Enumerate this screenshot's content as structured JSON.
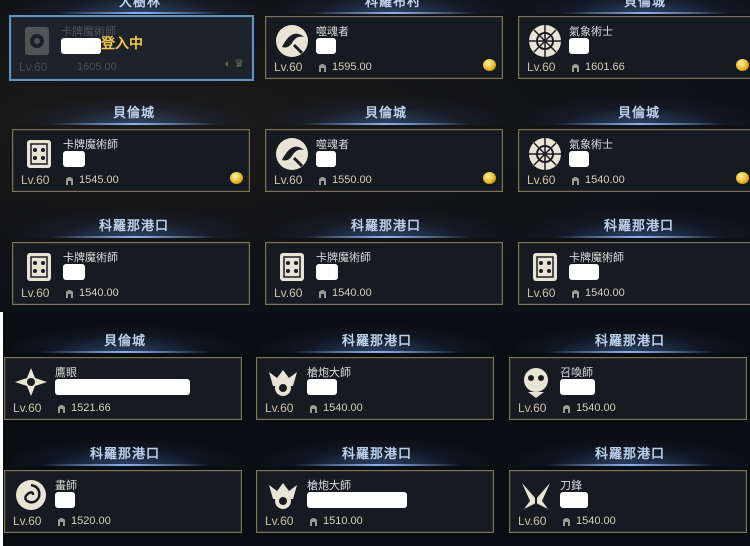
{
  "headers_top": [
    "大樹林",
    "科羅布村",
    "貝倫城"
  ],
  "row1": [
    {
      "class": "卡牌魔術師",
      "level": "Lv.60",
      "ilvl": "1605.00",
      "status": "登入中",
      "selected": true,
      "emblem": "card-master-emblem"
    },
    {
      "class": "噬魂者",
      "level": "Lv.60",
      "ilvl": "1595.00",
      "coin": true,
      "emblem": "reaper-emblem"
    },
    {
      "class": "氣象術士",
      "level": "Lv.60",
      "ilvl": "1601.66",
      "coin": true,
      "emblem": "aeromancer-emblem"
    }
  ],
  "headers_row2": [
    "貝倫城",
    "貝倫城",
    "貝倫城"
  ],
  "row2": [
    {
      "class": "卡牌魔術師",
      "level": "Lv.60",
      "ilvl": "1545.00",
      "coin": true,
      "emblem": "card-master-emblem"
    },
    {
      "class": "噬魂者",
      "level": "Lv.60",
      "ilvl": "1550.00",
      "coin": true,
      "emblem": "reaper-emblem"
    },
    {
      "class": "氣象術士",
      "level": "Lv.60",
      "ilvl": "1540.00",
      "coin": true,
      "emblem": "aeromancer-emblem"
    }
  ],
  "headers_row3": [
    "科羅那港口",
    "科羅那港口",
    "科羅那港口"
  ],
  "row3": [
    {
      "class": "卡牌魔術師",
      "level": "Lv.60",
      "ilvl": "1540.00",
      "emblem": "card-master-emblem"
    },
    {
      "class": "卡牌魔術師",
      "level": "Lv.60",
      "ilvl": "1540.00",
      "emblem": "card-master-emblem"
    },
    {
      "class": "卡牌魔術師",
      "level": "Lv.60",
      "ilvl": "1540.00",
      "emblem": "card-master-emblem"
    }
  ],
  "headers_row4": [
    "貝倫城",
    "科羅那港口",
    "科羅那港口"
  ],
  "row4": [
    {
      "class": "鷹眼",
      "level": "Lv.60",
      "ilvl": "1521.66",
      "emblem": "sharpshooter-emblem"
    },
    {
      "class": "槍炮大師",
      "level": "Lv.60",
      "ilvl": "1540.00",
      "emblem": "artillerist-emblem"
    },
    {
      "class": "召喚師",
      "level": "Lv.60",
      "ilvl": "1540.00",
      "emblem": "summoner-emblem"
    }
  ],
  "headers_row5": [
    "科羅那港口",
    "科羅那港口",
    "科羅那港口"
  ],
  "row5": [
    {
      "class": "畫師",
      "level": "Lv.60",
      "ilvl": "1520.00",
      "emblem": "artist-emblem"
    },
    {
      "class": "槍炮大師",
      "level": "Lv.60",
      "ilvl": "1510.00",
      "emblem": "artillerist-emblem"
    },
    {
      "class": "刀鋒",
      "level": "Lv.60",
      "ilvl": "1540.00",
      "emblem": "deathblade-emblem"
    }
  ],
  "colors": {
    "gold": "#f2c94c",
    "frame": "#7c7456",
    "selected": "#5a96c8",
    "header": "#bcd0ea"
  }
}
